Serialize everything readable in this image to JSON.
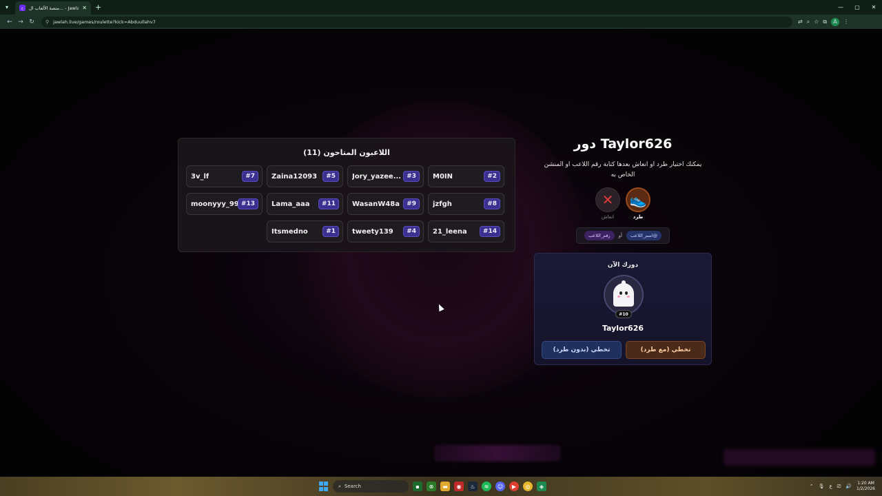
{
  "browser": {
    "tab_title": "منصة الألعاب ال... - Jawlah | جولة",
    "url": "jawlah.live/games/roulette?kick=Abduullahv7",
    "favicon": "ج"
  },
  "players_panel": {
    "title": "اللاعبون المتاحون (11)",
    "players": [
      {
        "name": "3v_lf",
        "num": "#7"
      },
      {
        "name": "Zaina12093",
        "num": "#5"
      },
      {
        "name": "Jory_yazee...",
        "num": "#3"
      },
      {
        "name": "M0IN",
        "num": "#2"
      },
      {
        "name": "moonyyy_99",
        "num": "#13"
      },
      {
        "name": "Lama_aaa",
        "num": "#11"
      },
      {
        "name": "WasanW48a",
        "num": "#9"
      },
      {
        "name": "jzfgh",
        "num": "#8"
      },
      {
        "name": "Itsmedno",
        "num": "#1"
      },
      {
        "name": "tweety139",
        "num": "#4"
      },
      {
        "name": "21_leena",
        "num": "#14"
      }
    ]
  },
  "turn": {
    "title": "دور Taylor626",
    "description": "يمكنك اختيار طرد او انعاش بعدها كتابة رقم اللاعب او المنشن الخاص به",
    "kick_label": "طرد",
    "revive_label": "انعاش",
    "hint_name": "@اسم_اللاعب",
    "hint_or": "أو",
    "hint_number": "رقم_اللاعب"
  },
  "now_card": {
    "label": "دورك الآن",
    "player_name": "Taylor626",
    "player_num": "#10",
    "btn_skip_kick": "تخطي (مع طرد)",
    "btn_skip_nokick": "تخطي (بدون طرد)"
  },
  "taskbar": {
    "search_label": "Search",
    "time": "1:20 AM",
    "date": "1/2/2026"
  },
  "colors": {
    "accent_number": "#3b2f8f",
    "kick_button": "#4a2a18",
    "nokick_button": "#1f2f5e"
  }
}
